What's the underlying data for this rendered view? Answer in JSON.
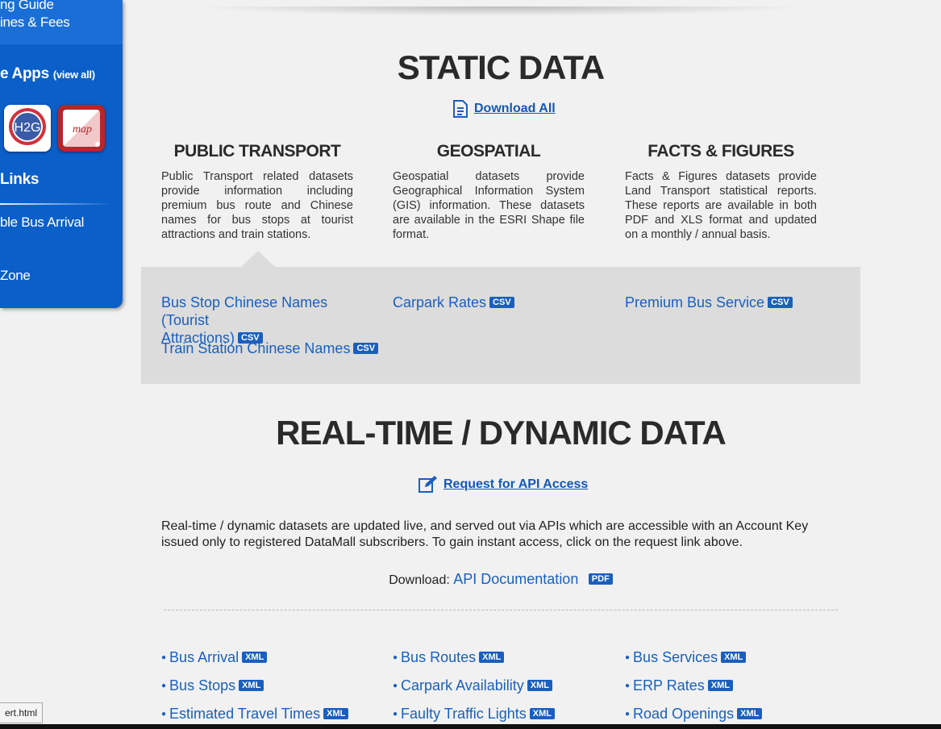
{
  "sidebar": {
    "link_guide": "ng Guide",
    "link_fines": "ines & Fees",
    "apps_heading": "e Apps",
    "apps_view_all": "(view all)",
    "app1_label": "H2G",
    "app2_label": "map",
    "links_heading": "Links",
    "link_bus_arrival": "ble Bus Arrival",
    "link_partial": "",
    "link_zone": "Zone"
  },
  "static": {
    "title": "STATIC DATA",
    "download_all": "Download All",
    "columns": [
      {
        "title": "PUBLIC TRANSPORT",
        "desc": "Public Transport related datasets provide information including premium bus route and Chinese names for bus stops at tourist attractions and train stations."
      },
      {
        "title": "GEOSPATIAL",
        "desc": "Geospatial datasets provide Geographical Information System (GIS) information. These datasets are available in the ESRI Shape file format."
      },
      {
        "title": "FACTS & FIGURES",
        "desc": "Facts & Figures datasets provide Land Transport statistical reports. These reports are available in both PDF and XLS format and updated on a monthly / annual basis."
      }
    ],
    "datasets": {
      "bus_stop_cn_1": "Bus Stop Chinese Names (Tourist",
      "bus_stop_cn_2": "Attractions)",
      "train_station_cn": "Train Station Chinese Names",
      "carpark_rates": "Carpark Rates",
      "premium_bus": "Premium Bus Service",
      "tag_csv": "CSV"
    }
  },
  "realtime": {
    "title": "REAL-TIME / DYNAMIC DATA",
    "request_api": "Request for API Access",
    "description": "Real-time / dynamic datasets are updated live, and served out via APIs which are accessible with an Account Key issued only to registered DataMall subscribers. To gain instant access, click on the request link above.",
    "download_label": "Download:",
    "api_doc": "API Documentation",
    "tag_pdf": "PDF",
    "tag_xml": "XML",
    "apis": [
      "Bus Arrival",
      "Bus Routes",
      "Bus Services",
      "Bus Stops",
      "Carpark Availability",
      "ERP Rates",
      "Estimated Travel Times",
      "Faulty Traffic Lights",
      "Road Openings"
    ]
  },
  "status_bar": {
    "url_fragment": "ert.html"
  },
  "colors": {
    "sidebar_blue": "#0b5fc9",
    "link_blue": "#1a5fbf",
    "band_grey": "#dcdcdc"
  }
}
